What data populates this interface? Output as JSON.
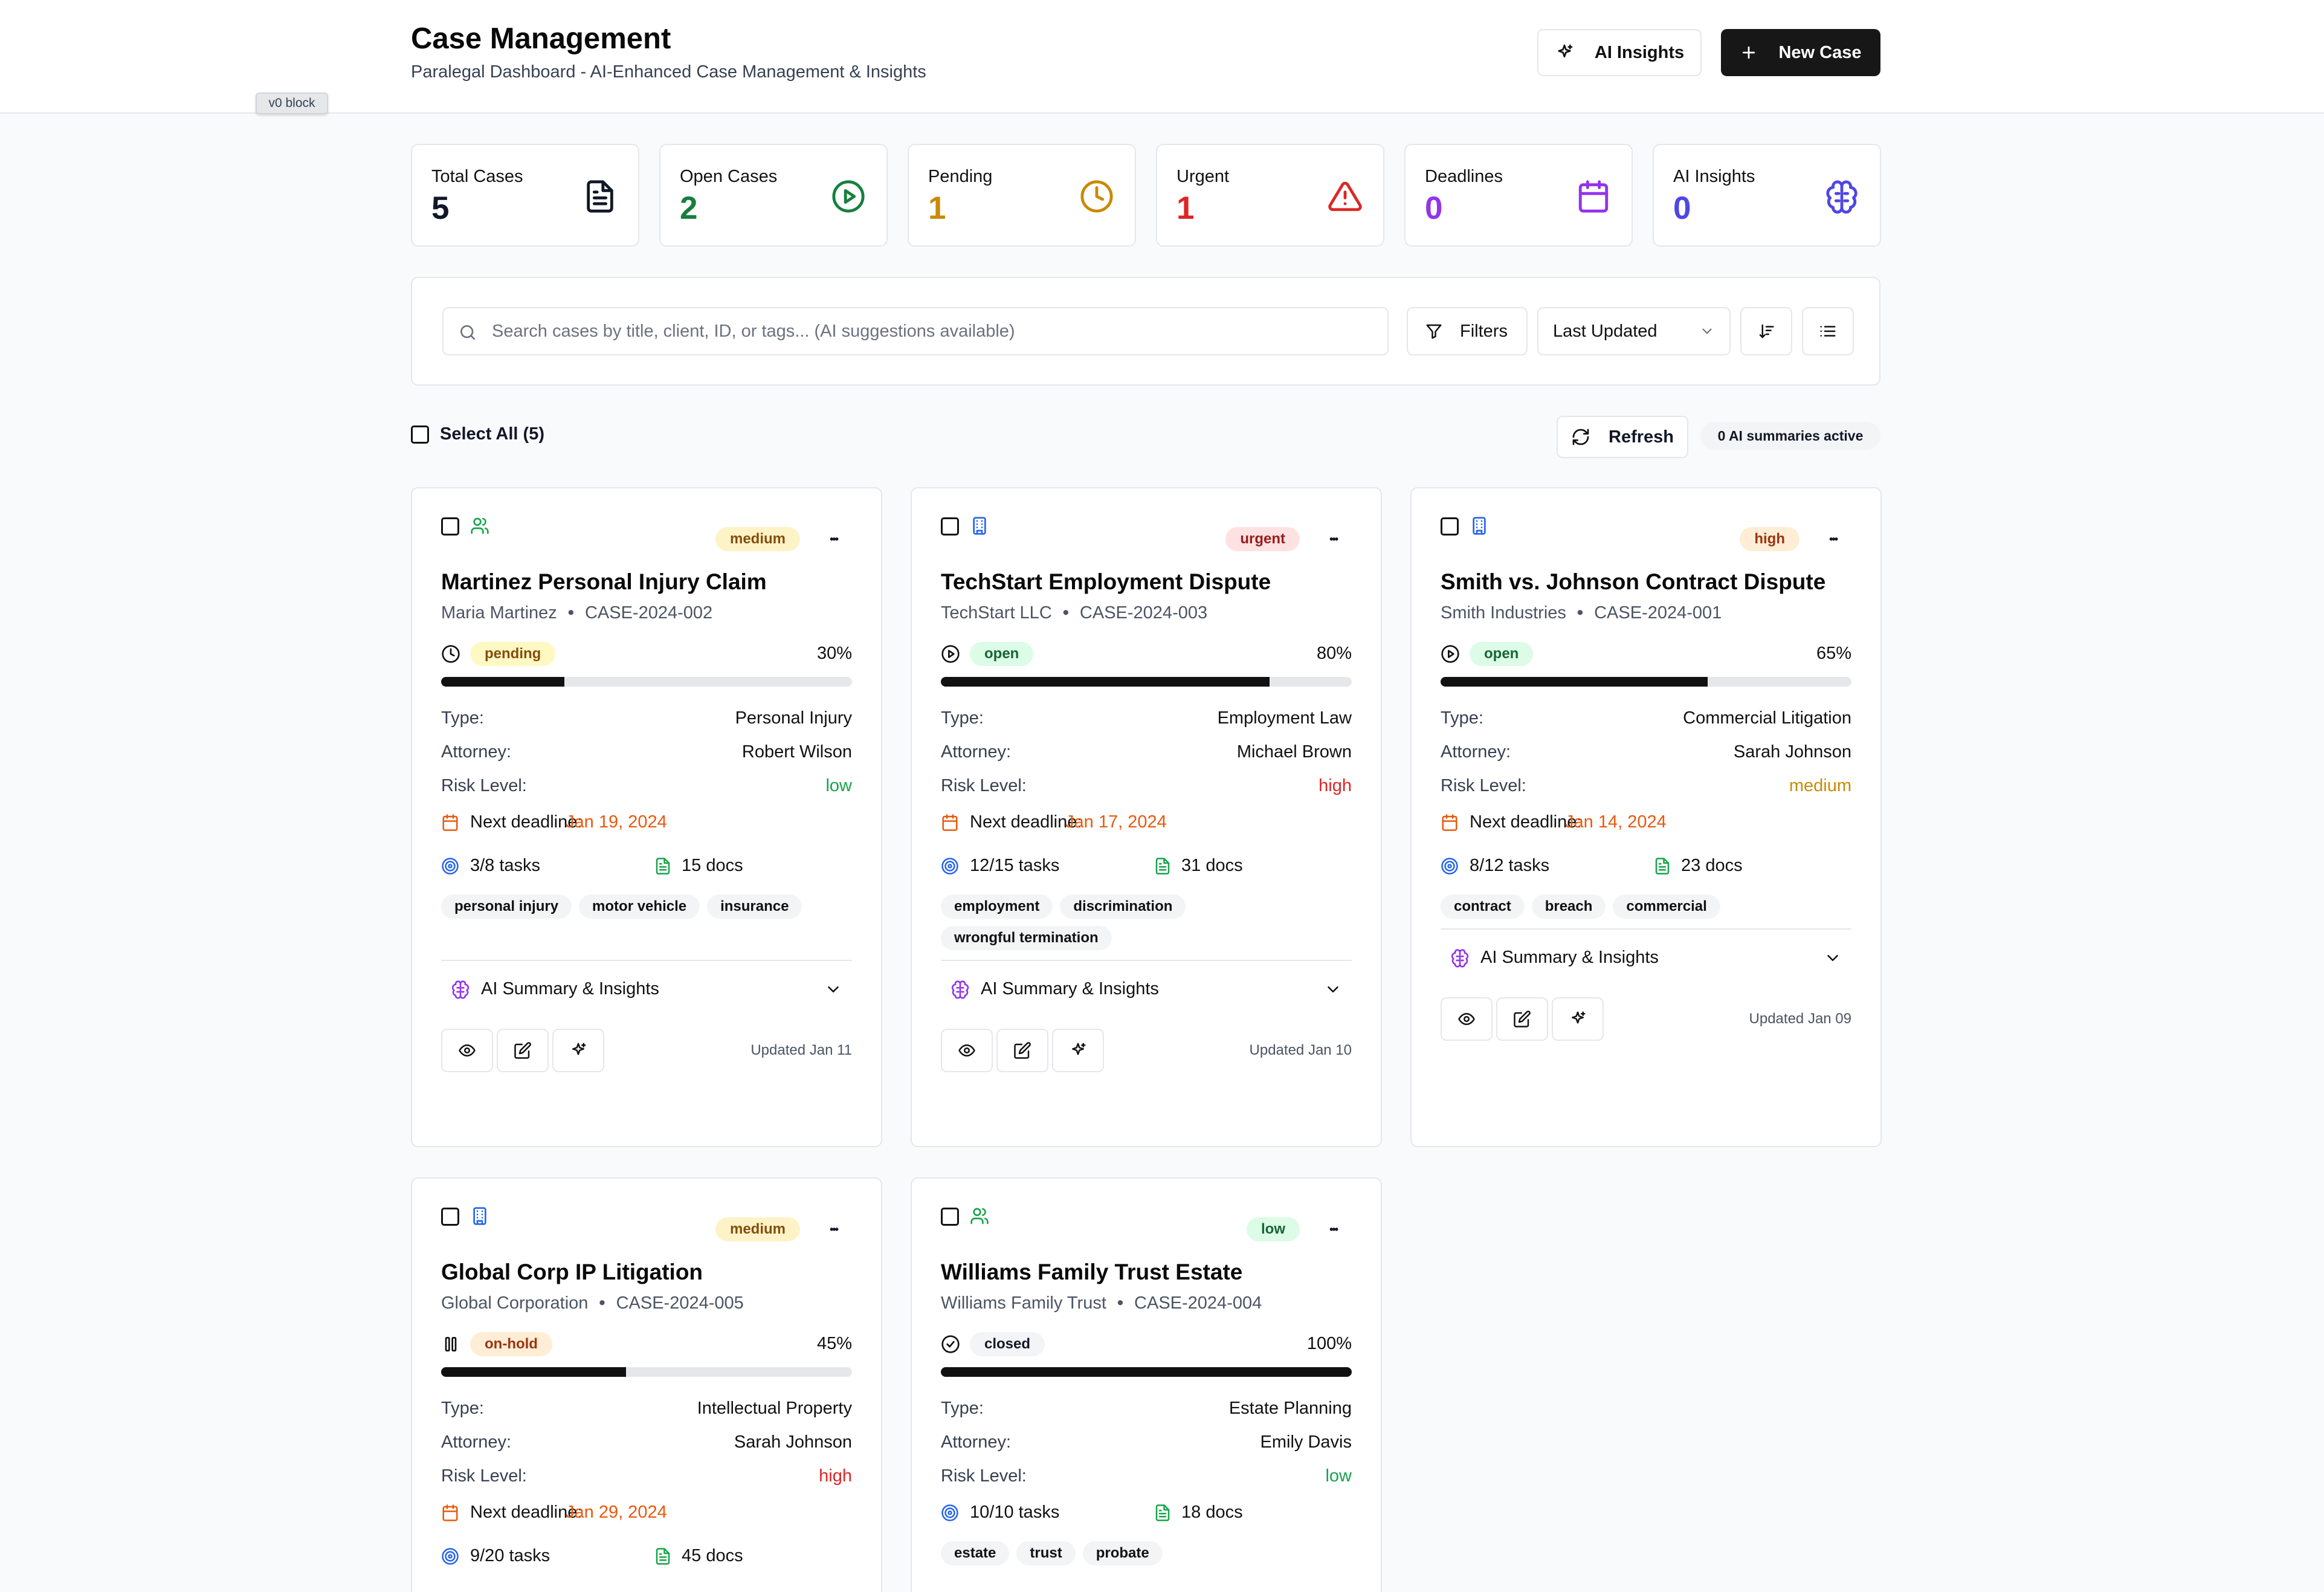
{
  "header": {
    "title": "Case Management",
    "subtitle": "Paralegal Dashboard - AI-Enhanced Case Management & Insights",
    "ai_insights_label": "AI Insights",
    "new_case_label": "New Case",
    "v0_tag": "v0 block"
  },
  "stats": [
    {
      "label": "Total Cases",
      "value": "5",
      "color": "#111827",
      "icon": "file-text-icon"
    },
    {
      "label": "Open Cases",
      "value": "2",
      "color": "#15803d",
      "icon": "play-circle-icon"
    },
    {
      "label": "Pending",
      "value": "1",
      "color": "#ca8a04",
      "icon": "clock-icon"
    },
    {
      "label": "Urgent",
      "value": "1",
      "color": "#dc2626",
      "icon": "alert-triangle-icon"
    },
    {
      "label": "Deadlines",
      "value": "0",
      "color": "#9333ea",
      "icon": "calendar-icon"
    },
    {
      "label": "AI Insights",
      "value": "0",
      "color": "#4f46e5",
      "icon": "brain-icon"
    }
  ],
  "search": {
    "placeholder": "Search cases by title, client, ID, or tags... (AI suggestions available)",
    "filters_label": "Filters",
    "sort_value": "Last Updated"
  },
  "toolbar": {
    "select_all": "Select All (5)",
    "refresh": "Refresh",
    "ai_summaries": "0 AI summaries active"
  },
  "labels": {
    "type": "Type:",
    "attorney": "Attorney:",
    "risk": "Risk Level:",
    "next_deadline": "Next deadline:",
    "ai_summary": "AI Summary & Insights"
  },
  "cases": [
    {
      "title": "Martinez Personal Injury Claim",
      "client": "Maria Martinez",
      "id": "CASE-2024-002",
      "priority": "medium",
      "status": "pending",
      "progress": 30,
      "progress_label": "30%",
      "type": "Personal Injury",
      "attorney": "Robert Wilson",
      "risk": "low",
      "deadline": "Jan 19, 2024",
      "tasks": "3/8 tasks",
      "docs": "15 docs",
      "tags": [
        "personal injury",
        "motor vehicle",
        "insurance"
      ],
      "updated": "Updated Jan 11",
      "client_icon": "users-icon"
    },
    {
      "title": "TechStart Employment Dispute",
      "client": "TechStart LLC",
      "id": "CASE-2024-003",
      "priority": "urgent",
      "status": "open",
      "progress": 80,
      "progress_label": "80%",
      "type": "Employment Law",
      "attorney": "Michael Brown",
      "risk": "high",
      "deadline": "Jan 17, 2024",
      "tasks": "12/15 tasks",
      "docs": "31 docs",
      "tags": [
        "employment",
        "discrimination",
        "wrongful termination"
      ],
      "updated": "Updated Jan 10",
      "client_icon": "building-icon"
    },
    {
      "title": "Smith vs. Johnson Contract Dispute",
      "client": "Smith Industries",
      "id": "CASE-2024-001",
      "priority": "high",
      "status": "open",
      "progress": 65,
      "progress_label": "65%",
      "type": "Commercial Litigation",
      "attorney": "Sarah Johnson",
      "risk": "medium",
      "deadline": "Jan 14, 2024",
      "tasks": "8/12 tasks",
      "docs": "23 docs",
      "tags": [
        "contract",
        "breach",
        "commercial"
      ],
      "updated": "Updated Jan 09",
      "client_icon": "building-icon"
    },
    {
      "title": "Global Corp IP Litigation",
      "client": "Global Corporation",
      "id": "CASE-2024-005",
      "priority": "medium",
      "status": "on-hold",
      "progress": 45,
      "progress_label": "45%",
      "type": "Intellectual Property",
      "attorney": "Sarah Johnson",
      "risk": "high",
      "deadline": "Jan 29, 2024",
      "tasks": "9/20 tasks",
      "docs": "45 docs",
      "tags": [],
      "updated": "",
      "client_icon": "building-icon"
    },
    {
      "title": "Williams Family Trust Estate",
      "client": "Williams Family Trust",
      "id": "CASE-2024-004",
      "priority": "low",
      "status": "closed",
      "progress": 100,
      "progress_label": "100%",
      "type": "Estate Planning",
      "attorney": "Emily Davis",
      "risk": "low",
      "deadline": "",
      "tasks": "10/10 tasks",
      "docs": "18 docs",
      "tags": [
        "estate",
        "trust",
        "probate"
      ],
      "updated": "",
      "client_icon": "users-icon"
    }
  ],
  "colors": {
    "priority": {
      "medium": [
        "#fef3c7",
        "#854d0e"
      ],
      "urgent": [
        "#fee2e2",
        "#991b1b"
      ],
      "high": [
        "#ffedd5",
        "#9a3412"
      ],
      "low": [
        "#dcfce7",
        "#166534"
      ]
    },
    "status": {
      "pending": [
        "#fef9c3",
        "#854d0e"
      ],
      "open": [
        "#dcfce7",
        "#166534"
      ],
      "on-hold": [
        "#ffedd5",
        "#9a3412"
      ],
      "closed": [
        "#f3f4f6",
        "#111827"
      ]
    },
    "risk": {
      "low": "#16a34a",
      "high": "#dc2626",
      "medium": "#ca8a04"
    },
    "deadline": "#ea580c"
  }
}
